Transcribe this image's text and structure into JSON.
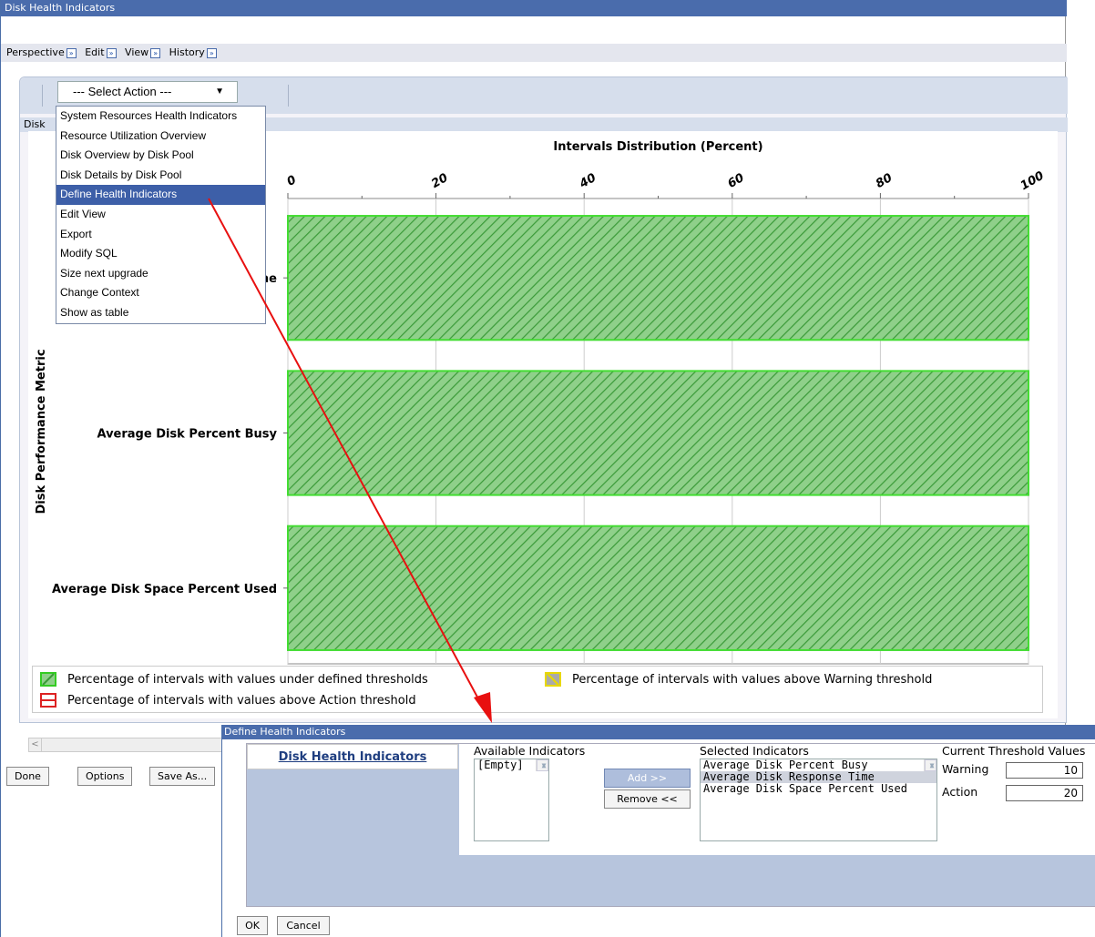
{
  "window": {
    "title": "Disk Health Indicators"
  },
  "menu": [
    {
      "label": "Perspective"
    },
    {
      "label": "Edit"
    },
    {
      "label": "View"
    },
    {
      "label": "History"
    }
  ],
  "toolbar": {
    "select_label": "--- Select Action ---"
  },
  "tab": {
    "label": "Disk"
  },
  "actions": [
    "System Resources Health Indicators",
    "Resource Utilization Overview",
    "Disk Overview by Disk Pool",
    "Disk Details by Disk Pool",
    "Define Health Indicators",
    "Edit View",
    "Export",
    "Modify SQL",
    "Size next upgrade",
    "Change Context",
    "Show as table"
  ],
  "selected_action_index": 4,
  "chart_data": {
    "type": "bar",
    "orientation": "horizontal",
    "title": "Intervals Distribution (Percent)",
    "ylabel": "Disk Performance Metric",
    "categories": [
      "Average Disk Response Time",
      "Average Disk Percent Busy",
      "Average Disk Space Percent Used"
    ],
    "visible_category_labels": [
      "ne",
      "Average Disk Percent Busy",
      "Average Disk Space Percent Used"
    ],
    "xlim": [
      0,
      100
    ],
    "xticks": [
      "0",
      "20",
      "40",
      "60",
      "80",
      "100"
    ],
    "series": [
      {
        "name": "Percentage of intervals with values under defined thresholds",
        "values": [
          100,
          100,
          100
        ],
        "color": "#44dd33"
      },
      {
        "name": "Percentage of intervals with values above Warning threshold",
        "values": [
          0,
          0,
          0
        ],
        "color": "#e8d800"
      },
      {
        "name": "Percentage of intervals with values above Action threshold",
        "values": [
          0,
          0,
          0
        ],
        "color": "#dd2222"
      }
    ],
    "grid": true,
    "legend_position": "bottom"
  },
  "footer_buttons": {
    "done": "Done",
    "options": "Options",
    "save_as": "Save As..."
  },
  "dialog": {
    "title": "Define Health Indicators",
    "left_header": "Disk Health Indicators",
    "available_label": "Available Indicators",
    "available_items": [
      "[Empty]"
    ],
    "add_label": "Add >>",
    "remove_label": "Remove <<",
    "selected_label": "Selected Indicators",
    "selected_items": [
      "Average Disk Percent Busy",
      "Average Disk Response Time",
      "Average Disk Space Percent Used"
    ],
    "selected_highlight_index": 1,
    "threshold_label": "Current Threshold Values",
    "warning_label": "Warning",
    "warning_value": "10",
    "action_label": "Action",
    "action_value": "20",
    "ok_label": "OK",
    "cancel_label": "Cancel"
  },
  "colors": {
    "titlebar": "#4a6cac",
    "highlight": "#3d5fa8",
    "arrow": "#e81010"
  }
}
